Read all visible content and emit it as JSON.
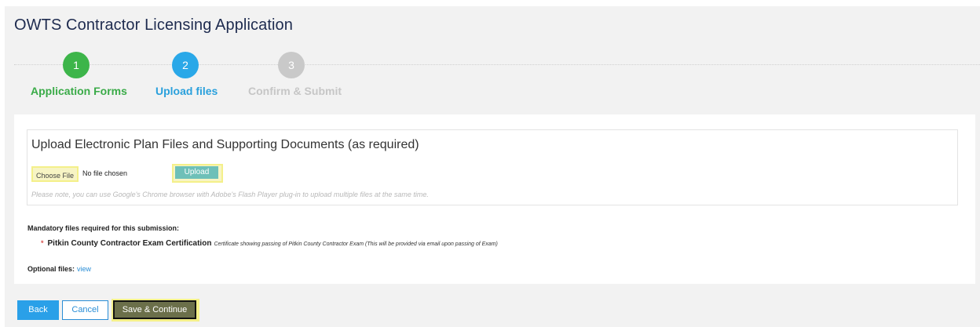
{
  "page": {
    "title": "OWTS Contractor Licensing Application"
  },
  "steps": [
    {
      "number": "1",
      "label": "Application Forms",
      "state": "complete",
      "color": "#3db54a"
    },
    {
      "number": "2",
      "label": "Upload files",
      "state": "active",
      "color": "#2aa8e8"
    },
    {
      "number": "3",
      "label": "Confirm & Submit",
      "state": "inactive",
      "color": "#c9c9c9"
    }
  ],
  "upload": {
    "title": "Upload Electronic Plan Files and Supporting Documents (as required)",
    "choose_file_label": "Choose File",
    "no_file_text": "No file chosen",
    "upload_label": "Upload",
    "note": "Please note, you can use Google's Chrome browser with Adobe's Flash Player plug-in to upload multiple files at the same time."
  },
  "mandatory": {
    "heading": "Mandatory files required for this submission:",
    "items": [
      {
        "marker": "*",
        "name": "Pitkin County Contractor Exam Certification",
        "description": "Certificate showing passing of Pitkin County Contractor Exam (This will be provided via email upon passing of Exam)"
      }
    ]
  },
  "optional": {
    "label": "Optional files:",
    "link": "view"
  },
  "actions": {
    "back": "Back",
    "cancel": "Cancel",
    "save": "Save & Continue"
  },
  "colors": {
    "accent_blue": "#2aa0e8",
    "highlight_yellow": "#f4f08a",
    "title_navy": "#1e2b4f"
  }
}
